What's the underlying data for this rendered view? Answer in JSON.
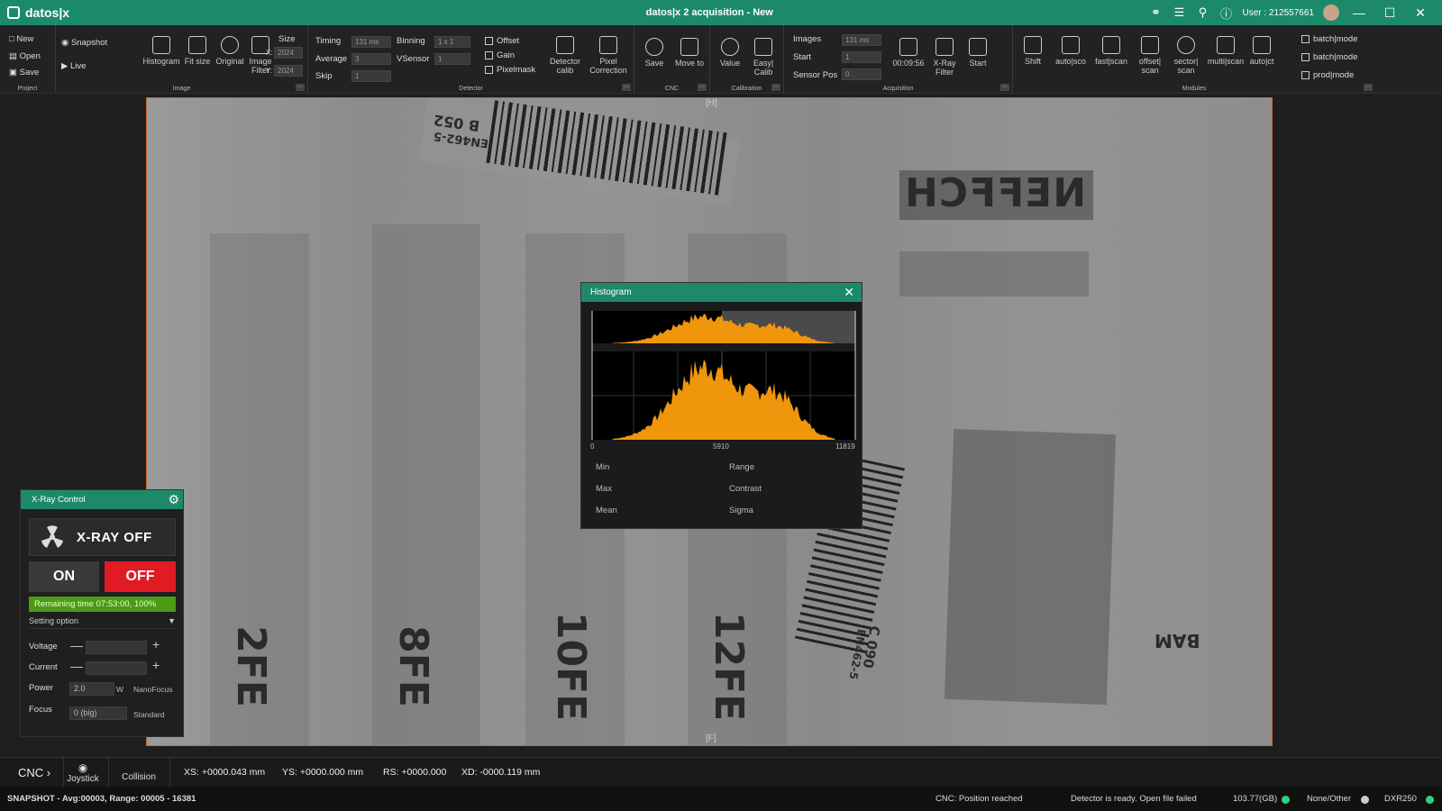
{
  "app": {
    "logo": "datos|x",
    "title": "datos|x 2 acquisition - New",
    "user": "User : 212557661"
  },
  "ribbon": {
    "project": {
      "label": "Project",
      "new": "New",
      "open": "Open",
      "save": "Save"
    },
    "image": {
      "label": "Image",
      "snapshot": "Snapshot",
      "live": "Live",
      "histogram": "Histogram",
      "fit_size": "Fit size",
      "original": "Original",
      "image_filter": "Image Filter",
      "size_label": "Size",
      "x_label": "X:",
      "x_value": "2024",
      "y_label": "Y:",
      "y_value": "2024"
    },
    "detector": {
      "label": "Detector",
      "timing_label": "Timing",
      "timing_value": "131 ms",
      "average_label": "Average",
      "average_value": "3",
      "skip_label": "Skip",
      "skip_value": "1",
      "binning_label": "Binning",
      "binning_value": "1 x 1",
      "vsensor_label": "VSensor",
      "vsensor_value": "1",
      "offset": "Offset",
      "gain": "Gain",
      "pixelmask": "Pixelmask",
      "detector_calib": "Detector calib",
      "pixel_correction": "Pixel Correction"
    },
    "cnc": {
      "label": "CNC",
      "save": "Save",
      "move_to": "Move to"
    },
    "calibration": {
      "label": "Calibration",
      "value": "Value",
      "easy_calib": "Easy| Calib"
    },
    "acquisition": {
      "label": "Acquisition",
      "images_label": "Images",
      "images_value": "131 ms",
      "start_label": "Start",
      "start_value": "1",
      "sensor_pos_label": "Sensor Pos",
      "sensor_pos_value": "0",
      "time": "00:09:56",
      "xray_filter": "X-Ray Filter",
      "start": "Start"
    },
    "modules": {
      "label": "Modules",
      "items": [
        "Shift",
        "auto|sco",
        "fast|scan",
        "offset| scan",
        "sector| scan",
        "multi|scan",
        "auto|ct"
      ],
      "batch1": "batch|mode",
      "batch2": "batch|mode",
      "prod": "prod|mode"
    }
  },
  "image_view": {
    "top_marker": "[H]",
    "bottom_marker": "[F]",
    "stamps": {
      "b052": "B 052",
      "en462_b": "EN462-5",
      "c090": "C 090",
      "en462_c": "EN462-5",
      "bam": "BAM",
      "neffch": "NEFFCH",
      "fe2": "2FE",
      "fe8": "8FE",
      "fe10": "10FE",
      "fe12": "12FE"
    }
  },
  "histogram": {
    "title": "Histogram",
    "axis_min": "0",
    "axis_mid": "5910",
    "axis_max": "11819",
    "stats": {
      "min": "Min",
      "max": "Max",
      "mean": "Mean",
      "range": "Range",
      "contrast": "Contrast",
      "sigma": "Sigma"
    },
    "accent": "#f0960c"
  },
  "xray_control": {
    "title": "X-Ray Control",
    "state": "X-RAY OFF",
    "on": "ON",
    "off": "OFF",
    "remaining": "Remaining time 07:53:00, 100%",
    "setting_option": "Setting option",
    "voltage_label": "Voltage",
    "current_label": "Current",
    "power_label": "Power",
    "power_value": "2.0",
    "power_unit": "W",
    "power_mode": "NanoFocus",
    "focus_label": "Focus",
    "focus_value": "0 (big)",
    "focus_mode": "Standard",
    "on_color": "#3a3a3a",
    "off_color": "#e01b24",
    "remaining_color": "#4d9a16"
  },
  "cnc": {
    "label": "CNC",
    "joystick": "Joystick",
    "collision": "Collision",
    "xs": "XS: +0000.043 mm",
    "ys": "YS: +0000.000 mm",
    "rs": "RS: +0000.000",
    "xd": "XD: -0000.119 mm"
  },
  "status": {
    "left": "SNAPSHOT - Avg:00003, Range: 00005 - 16381",
    "cnc": "CNC: Position reached",
    "detector": "Detector is ready. Open file failed",
    "disk": "103.77(GB)",
    "none_other": "None/Other",
    "device": "DXR250"
  }
}
